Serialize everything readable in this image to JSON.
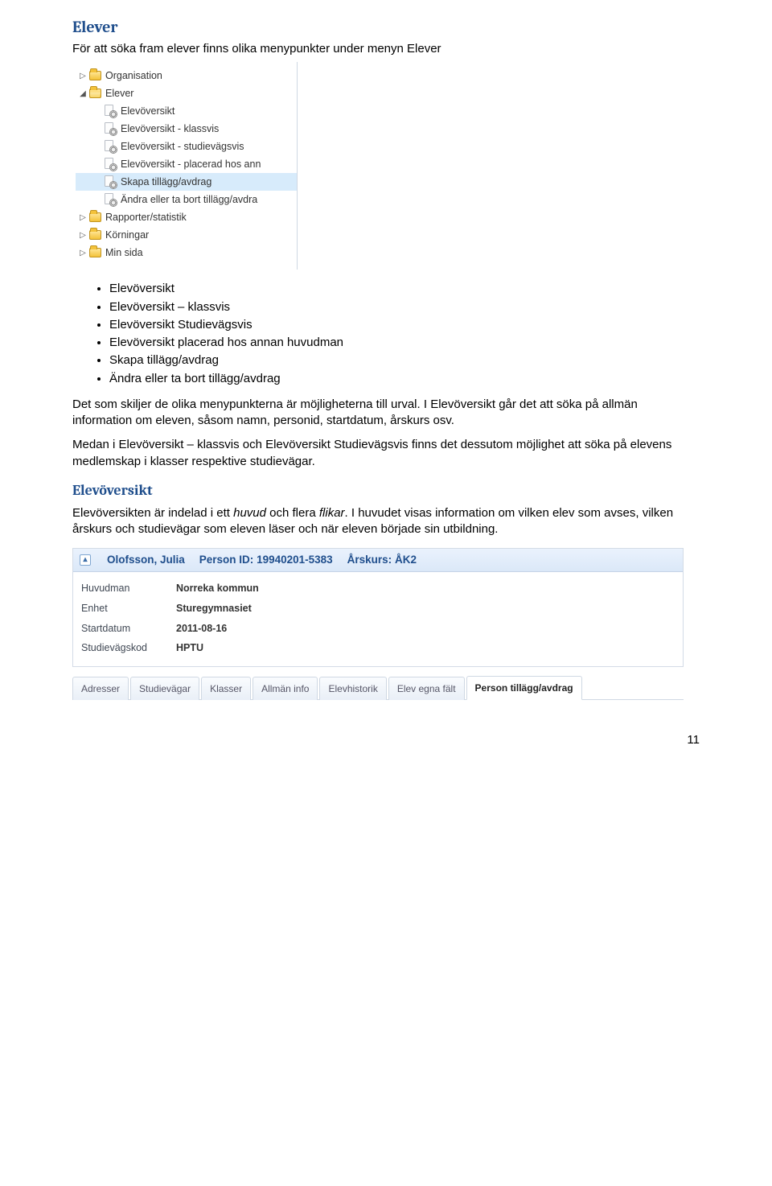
{
  "title": "Elever",
  "intro": "För att söka fram elever finns olika menypunkter under menyn Elever",
  "tree": [
    {
      "level": 0,
      "expandable": true,
      "expanded": false,
      "icon": "folder",
      "label": "Organisation"
    },
    {
      "level": 0,
      "expandable": true,
      "expanded": true,
      "icon": "folder-open",
      "label": "Elever"
    },
    {
      "level": 1,
      "expandable": false,
      "icon": "gear-page",
      "label": "Elevöversikt"
    },
    {
      "level": 1,
      "expandable": false,
      "icon": "gear-page",
      "label": "Elevöversikt - klassvis"
    },
    {
      "level": 1,
      "expandable": false,
      "icon": "gear-page",
      "label": "Elevöversikt - studievägsvis"
    },
    {
      "level": 1,
      "expandable": false,
      "icon": "gear-page",
      "label": "Elevöversikt - placerad hos ann"
    },
    {
      "level": 1,
      "expandable": false,
      "icon": "gear-page",
      "label": "Skapa tillägg/avdrag",
      "selected": true
    },
    {
      "level": 1,
      "expandable": false,
      "icon": "gear-page",
      "label": "Ändra eller ta bort tillägg/avdra"
    },
    {
      "level": 0,
      "expandable": true,
      "expanded": false,
      "icon": "folder",
      "label": "Rapporter/statistik"
    },
    {
      "level": 0,
      "expandable": true,
      "expanded": false,
      "icon": "folder",
      "label": "Körningar"
    },
    {
      "level": 0,
      "expandable": true,
      "expanded": false,
      "icon": "folder",
      "label": "Min sida"
    }
  ],
  "bullets": [
    "Elevöversikt",
    "Elevöversikt – klassvis",
    "Elevöversikt Studievägsvis",
    "Elevöversikt placerad hos annan huvudman",
    "Skapa tillägg/avdrag",
    "Ändra eller ta bort tillägg/avdrag"
  ],
  "para1": "Det som skiljer de olika menypunkterna är möjligheterna till urval. I Elevöversikt går det att söka på allmän information om eleven, såsom namn, personid, startdatum, årskurs osv.",
  "para2": "Medan i Elevöversikt – klassvis och Elevöversikt Studievägsvis finns det dessutom möjlighet att söka på elevens medlemskap i klasser respektive studievägar.",
  "subsection": "Elevöversikt",
  "para3a": "Elevöversikten är indelad i ett ",
  "para3b_italic": "huvud",
  "para3c": " och flera ",
  "para3d_italic": "flikar",
  "para3e": ". I huvudet visas information om vilken elev som avses, vilken årskurs och studievägar som eleven läser och när eleven började sin utbildning.",
  "panel": {
    "header": {
      "name": "Olofsson, Julia",
      "personid_label": "Person ID:",
      "personid_value": "19940201-5383",
      "arskurs_label": "Årskurs:",
      "arskurs_value": "ÅK2"
    },
    "rows": [
      {
        "label": "Huvudman",
        "value": "Norreka kommun"
      },
      {
        "label": "Enhet",
        "value": "Sturegymnasiet"
      },
      {
        "label": "Startdatum",
        "value": "2011-08-16"
      },
      {
        "label": "Studievägskod",
        "value": "HPTU"
      }
    ]
  },
  "tabs": [
    {
      "label": "Adresser",
      "active": false
    },
    {
      "label": "Studievägar",
      "active": false
    },
    {
      "label": "Klasser",
      "active": false
    },
    {
      "label": "Allmän info",
      "active": false
    },
    {
      "label": "Elevhistorik",
      "active": false
    },
    {
      "label": "Elev egna fält",
      "active": false
    },
    {
      "label": "Person tillägg/avdrag",
      "active": true
    }
  ],
  "page_number": "11"
}
